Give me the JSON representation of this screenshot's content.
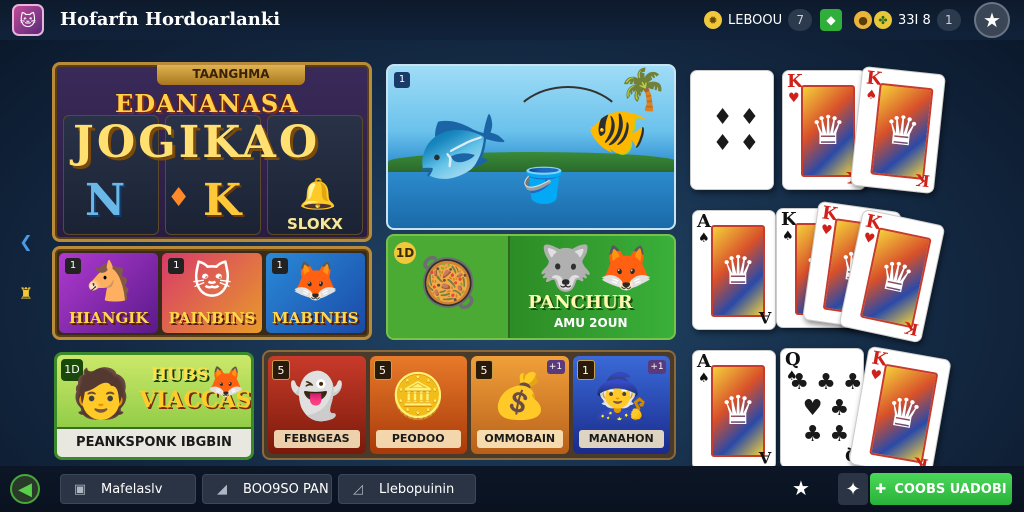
{
  "app": {
    "title": "Hofarfn Hordoarlanki",
    "logo_icon": "cat-mascot-icon"
  },
  "topbar": {
    "currency1_label": "LEBOOU",
    "currency1_btn": "7",
    "gem_icon": "gem-icon",
    "currency2_icon": "coin-stack-icon",
    "currency3_value": "33I 8",
    "currency3_btn": "1",
    "favorite_icon": "star-icon"
  },
  "jackpot": {
    "tab_label": "TAANGHMA",
    "line1": "EDANANASA",
    "line2": "JOGIKAO",
    "letter_n": "N",
    "letter_k": "K",
    "slot_label": "SLOKX"
  },
  "mini_games": [
    {
      "tag": "1",
      "label": "HIANGIK",
      "icon": "horse-icon"
    },
    {
      "tag": "1",
      "label": "PAINBINS",
      "icon": "cat-icon"
    },
    {
      "tag": "1",
      "label": "MABINHS",
      "icon": "fox-icon"
    }
  ],
  "fishing": {
    "tag": "1",
    "icon": "fish-icon"
  },
  "pancho": {
    "tag": "1D",
    "label": "PANCHUR",
    "sub": "AMU 2OUN"
  },
  "hub": {
    "tag": "1D",
    "title1": "HUBS",
    "title2": "VIACCAS",
    "bar": "PEANKSPONK IBGBIN"
  },
  "tiles": [
    {
      "tag": "5",
      "label": "FEBNGEAS",
      "icon": "ghost-icon",
      "corner": ""
    },
    {
      "tag": "5",
      "label": "PEODOO",
      "icon": "gold-coin-icon",
      "corner": ""
    },
    {
      "tag": "5",
      "label": "OMMOBAIN",
      "icon": "gold-bars-icon",
      "corner": "+1"
    },
    {
      "tag": "1",
      "label": "MANAHON",
      "icon": "witch-icon",
      "corner": "+1"
    }
  ],
  "cards": [
    {
      "rank": "",
      "suit": "",
      "face": "♦ ♦\n♦ ♦",
      "color": "red",
      "plain": true
    },
    {
      "rank": "K",
      "suit": "♥",
      "color": "red",
      "plain": false
    },
    {
      "rank": "K",
      "suit": "♠",
      "color": "red",
      "plain": false
    },
    {
      "rank": "A",
      "suit": "♠",
      "color": "blk",
      "plain": false
    },
    {
      "rank": "K",
      "suit": "♠",
      "color": "blk",
      "plain": false
    },
    {
      "rank": "K",
      "suit": "♥",
      "color": "red",
      "plain": false
    },
    {
      "rank": "K",
      "suit": "♥",
      "color": "red",
      "plain": false
    },
    {
      "rank": "A",
      "suit": "♠",
      "color": "blk",
      "plain": false
    },
    {
      "rank": "Q",
      "suit": "♠",
      "color": "blk",
      "plain": true,
      "face": "♣ ♣ ♣\n♥ ♣\n♣ ♣"
    },
    {
      "rank": "K",
      "suit": "♥",
      "color": "red",
      "plain": false
    }
  ],
  "bottom": {
    "back_icon": "arrow-left-icon",
    "btn1": "Mafelaslv",
    "btn2": "BOO9SO PAN",
    "btn3": "Llebopuinin",
    "cta": "COOBS UADOBI",
    "cta_icon": "plus-icon"
  }
}
